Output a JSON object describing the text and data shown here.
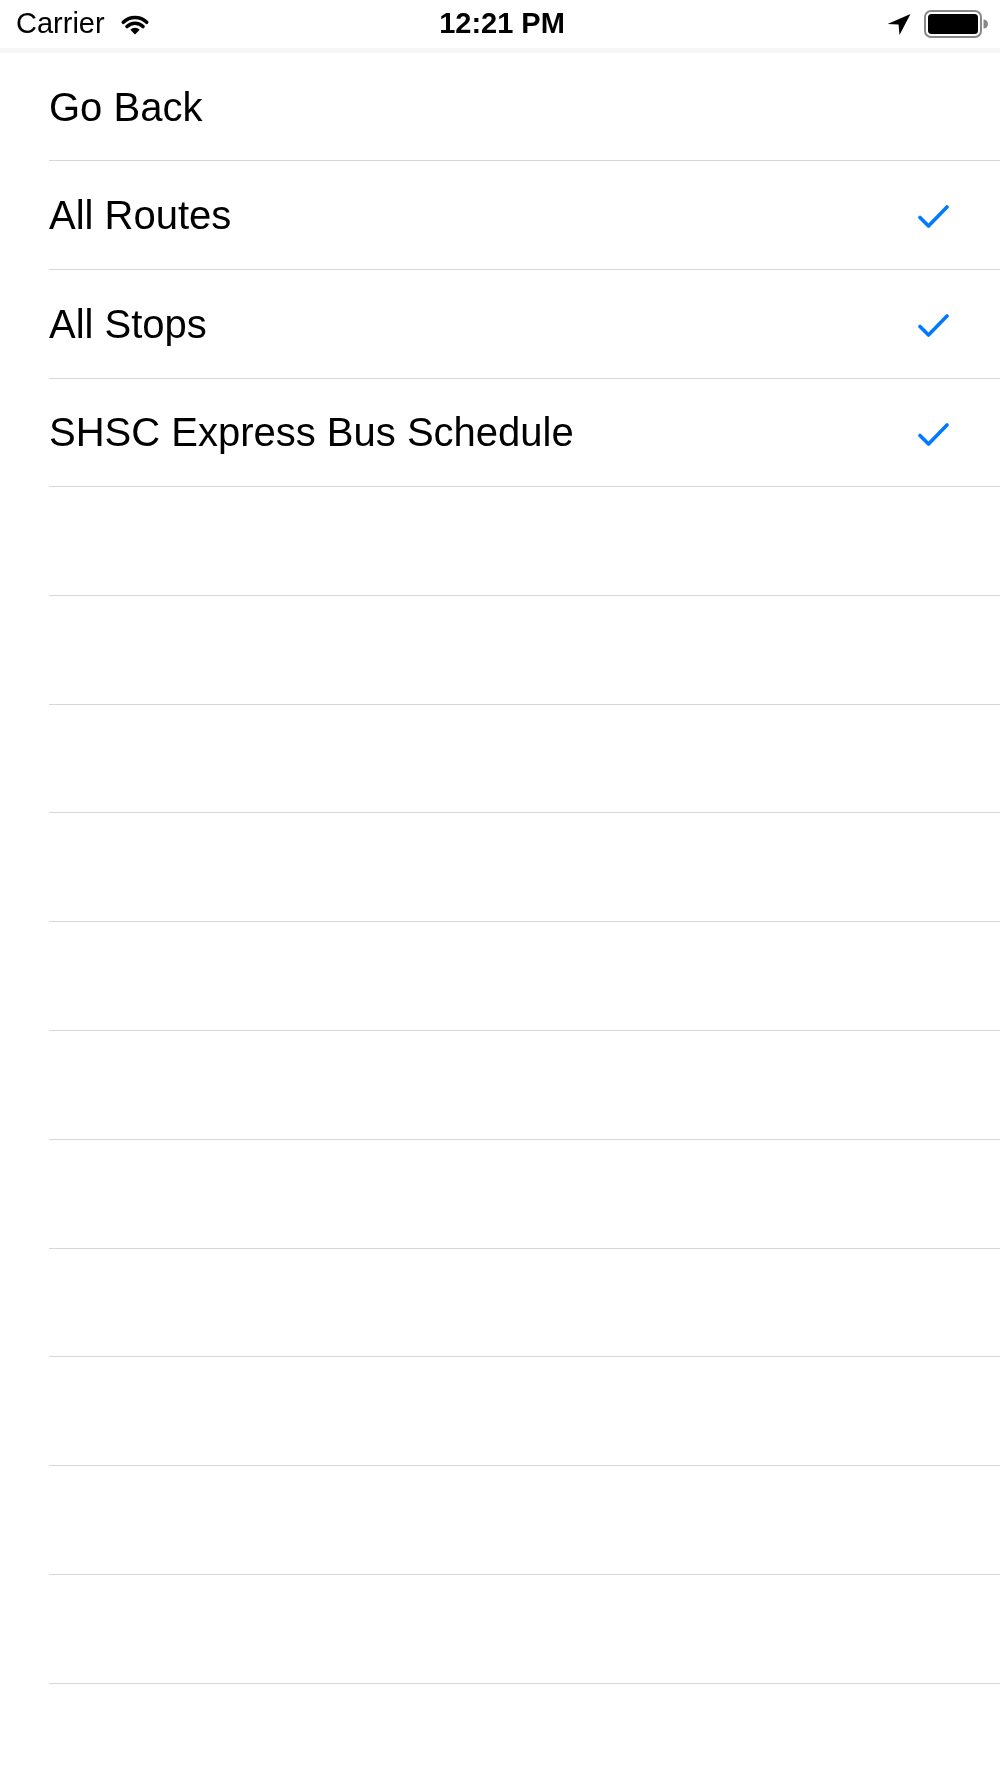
{
  "status_bar": {
    "carrier": "Carrier",
    "time": "12:21 PM"
  },
  "menu": {
    "items": [
      {
        "label": "Go Back",
        "checked": false
      },
      {
        "label": "All Routes",
        "checked": true
      },
      {
        "label": "All Stops",
        "checked": true
      },
      {
        "label": "SHSC Express Bus Schedule",
        "checked": true
      }
    ]
  }
}
